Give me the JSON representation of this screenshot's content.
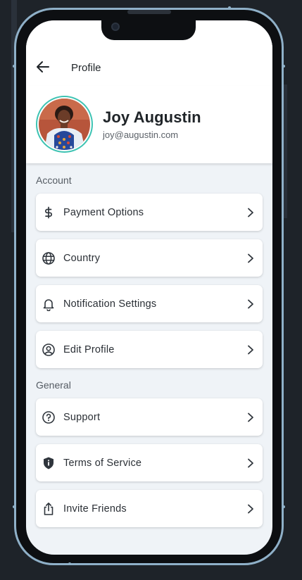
{
  "appbar": {
    "title": "Profile",
    "back_icon": "arrow-left-icon"
  },
  "profile": {
    "name": "Joy Augustin",
    "email": "joy@augustin.com",
    "avatar_ring_color": "#3ec3b3"
  },
  "sections": {
    "account": {
      "label": "Account",
      "items": [
        {
          "label": "Payment Options",
          "icon": "dollar-icon"
        },
        {
          "label": "Country",
          "icon": "globe-icon"
        },
        {
          "label": "Notification Settings",
          "icon": "bell-icon"
        },
        {
          "label": "Edit Profile",
          "icon": "user-circle-icon"
        }
      ]
    },
    "general": {
      "label": "General",
      "items": [
        {
          "label": "Support",
          "icon": "help-circle-icon"
        },
        {
          "label": "Terms of Service",
          "icon": "shield-icon"
        },
        {
          "label": "Invite Friends",
          "icon": "share-icon"
        }
      ]
    }
  },
  "colors": {
    "device_frame": "#8fb0c8",
    "screen_bg": "#eff3f7",
    "accent": "#3ec3b3"
  }
}
